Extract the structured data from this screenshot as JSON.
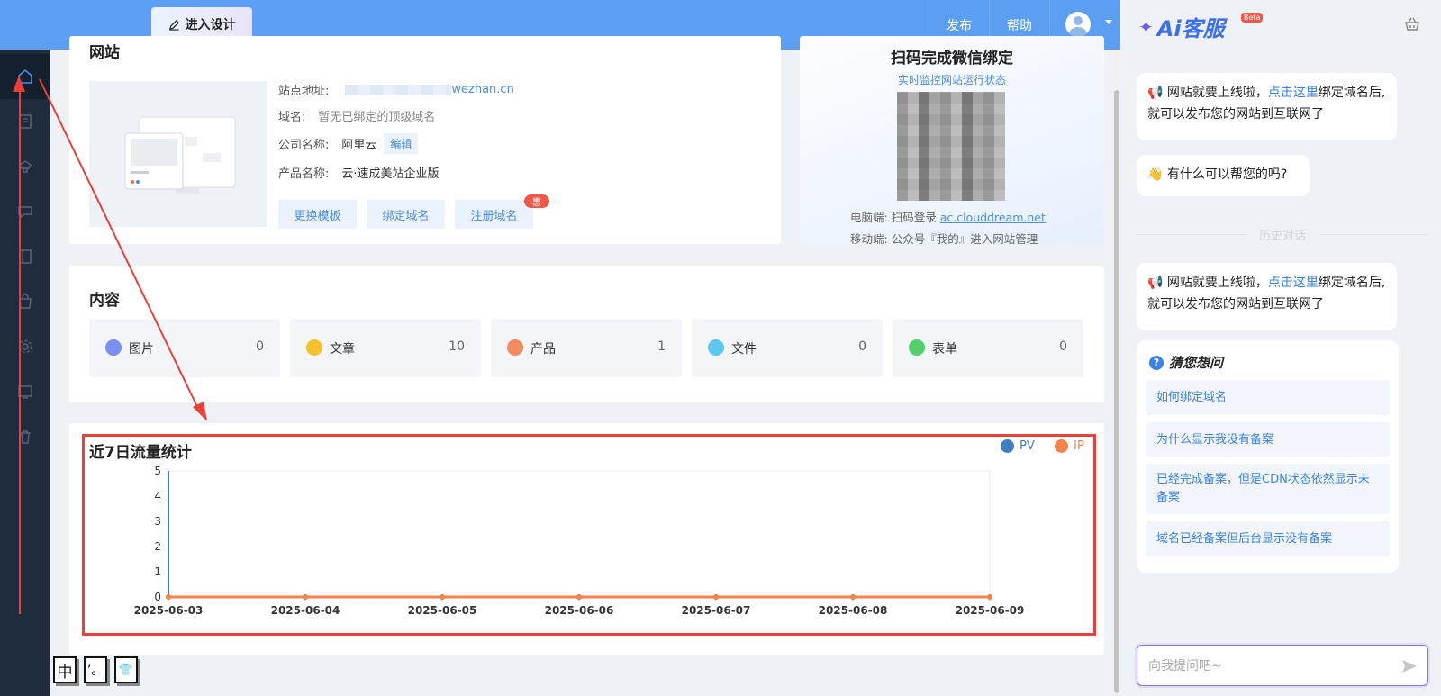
{
  "topbar": {
    "design_label": "进入设计",
    "publish_label": "发布",
    "help_label": "帮助"
  },
  "sidebar": {
    "items": [
      {
        "icon": "home-icon"
      },
      {
        "icon": "page-icon"
      },
      {
        "icon": "brush-icon"
      },
      {
        "icon": "chat-icon"
      },
      {
        "icon": "book-icon"
      },
      {
        "icon": "bag-icon"
      },
      {
        "icon": "gear-icon"
      },
      {
        "icon": "monitor-icon"
      },
      {
        "icon": "trash-icon"
      }
    ]
  },
  "site": {
    "title": "网站",
    "address_label": "站点地址:",
    "address_suffix": "wezhan.cn",
    "domain_label": "域名:",
    "domain_value": "暂无已绑定的顶级域名",
    "company_label": "公司名称:",
    "company_value": "阿里云",
    "edit_label": "编辑",
    "product_label": "产品名称:",
    "product_value": "云·速成美站企业版",
    "buttons": {
      "change_template": "更换模板",
      "bind_domain": "绑定域名",
      "register_domain": "注册域名"
    },
    "badge": "惠"
  },
  "wechat": {
    "title": "扫码完成微信绑定",
    "subtitle": "实时监控网站运行状态",
    "pc_label": "电脑端:",
    "pc_text": "扫码登录",
    "pc_link": "ac.clouddream.net",
    "mobile_label": "移动端:",
    "mobile_text": "公众号『我的』进入网站管理"
  },
  "content": {
    "title": "内容",
    "stats": [
      {
        "label": "图片",
        "count": "0",
        "color": "#7b8ff0"
      },
      {
        "label": "文章",
        "count": "10",
        "color": "#f5c22e"
      },
      {
        "label": "产品",
        "count": "1",
        "color": "#f58a5c"
      },
      {
        "label": "文件",
        "count": "0",
        "color": "#5cc8f0"
      },
      {
        "label": "表单",
        "count": "0",
        "color": "#52d16a"
      }
    ]
  },
  "traffic": {
    "title": "近7日流量统计"
  },
  "chart_data": {
    "type": "line",
    "title": "近7日流量统计",
    "categories": [
      "2025-06-03",
      "2025-06-04",
      "2025-06-05",
      "2025-06-06",
      "2025-06-07",
      "2025-06-08",
      "2025-06-09"
    ],
    "series": [
      {
        "name": "PV",
        "values": [
          0,
          0,
          0,
          0,
          0,
          0,
          0
        ],
        "color": "#3f7fbf"
      },
      {
        "name": "IP",
        "values": [
          0,
          0,
          0,
          0,
          0,
          0,
          0
        ],
        "color": "#f5834a"
      }
    ],
    "yticks": [
      "0",
      "1",
      "2",
      "3",
      "4",
      "5"
    ],
    "ylim": [
      0,
      5
    ],
    "legend": "top-right"
  },
  "ime": {
    "lang": "中",
    "punct": "’。",
    "skin": "👕"
  },
  "ai": {
    "logo_text": "Ai客服",
    "beta": "Beta",
    "msg1_a": "📢 网站就要上线啦，",
    "msg1_link": "点击这里",
    "msg1_b": "绑定域名后,就可以发布您的网站到互联网了",
    "msg2": "👋 有什么可以帮您的吗?",
    "history_label": "历史对话",
    "msg3_a": "📢 网站就要上线啦，",
    "msg3_link": "点击这里",
    "msg3_b": "绑定域名后,就可以发布您的网站到互联网了",
    "guess_title": "猜您想问",
    "questions": [
      "如何绑定域名",
      "为什么显示我没有备案",
      "已经完成备案，但是CDN状态依然显示未备案",
      "域名已经备案但后台显示没有备案"
    ],
    "input_placeholder": "向我提问吧~"
  }
}
